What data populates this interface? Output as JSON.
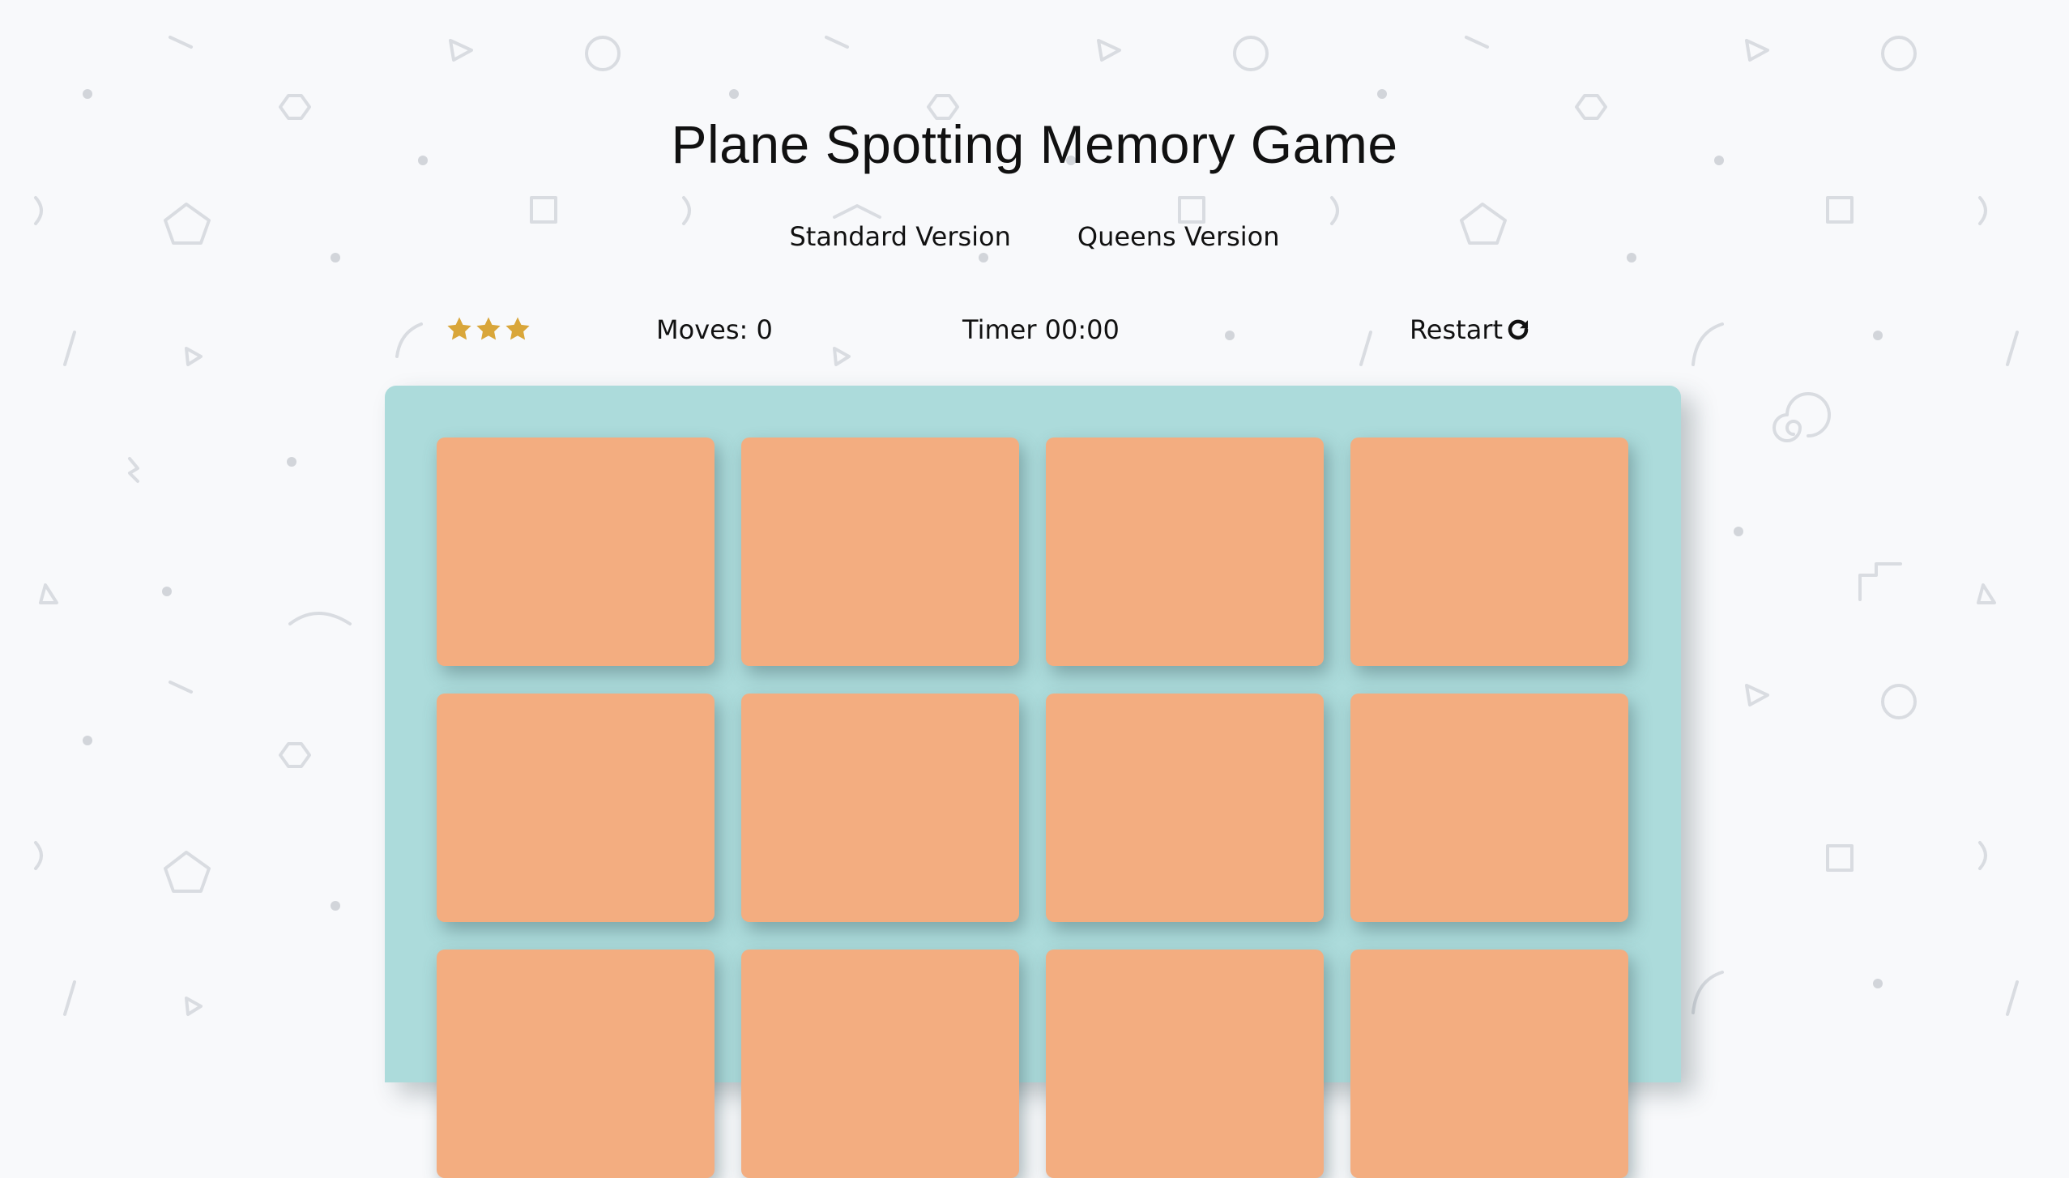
{
  "title": "Plane Spotting Memory Game",
  "versions": {
    "standard_label": "Standard Version",
    "queens_label": "Queens Version"
  },
  "score_panel": {
    "stars_filled": 3,
    "stars_total": 3,
    "moves_label": "Moves: 0",
    "timer_label": "Timer 00:00",
    "restart_label": "Restart"
  },
  "deck": {
    "columns": 4,
    "visible_rows": 3,
    "cards_visible": 12,
    "card_state": "face-down"
  },
  "colors": {
    "background": "#f8f9fb",
    "deck": "#acdbdb",
    "card_back": "#f3ad80",
    "star": "#d9a63a",
    "pattern": "#d7dadf"
  },
  "icons": {
    "star": "star-icon",
    "restart": "refresh-icon"
  }
}
